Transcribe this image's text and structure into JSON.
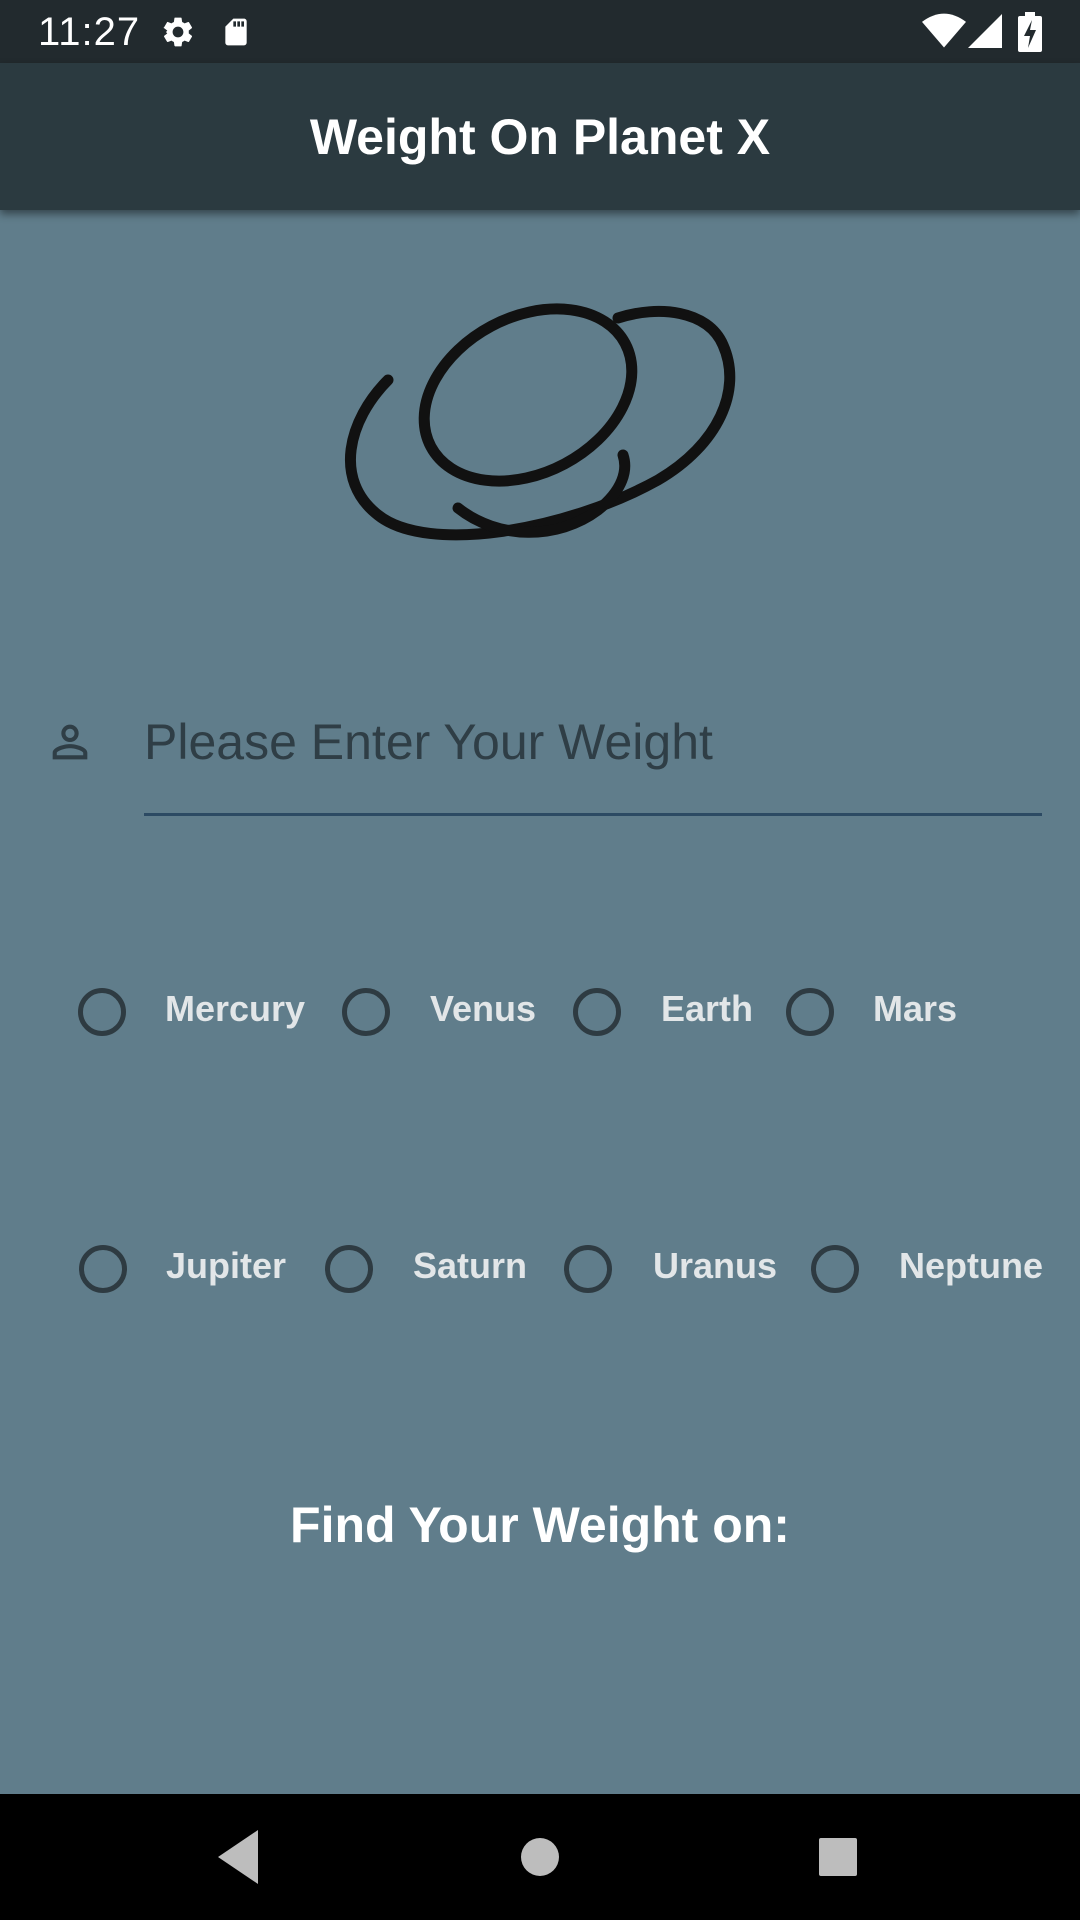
{
  "status_bar": {
    "time": "11:27",
    "icons": [
      "settings-icon",
      "sd-card-icon",
      "wifi-icon",
      "cell-signal-icon",
      "battery-charging-icon"
    ]
  },
  "app_bar": {
    "title": "Weight On Planet X"
  },
  "logo": {
    "icon": "planet-icon"
  },
  "weight_input": {
    "icon": "person-icon",
    "placeholder": "Please Enter Your Weight",
    "value": ""
  },
  "planets": {
    "row1": [
      {
        "label": "Mercury",
        "selected": false
      },
      {
        "label": "Venus",
        "selected": false
      },
      {
        "label": "Earth",
        "selected": false
      },
      {
        "label": "Mars",
        "selected": false
      }
    ],
    "row2": [
      {
        "label": "Jupiter",
        "selected": false
      },
      {
        "label": "Saturn",
        "selected": false
      },
      {
        "label": "Uranus",
        "selected": false
      },
      {
        "label": "Neptune",
        "selected": false
      }
    ]
  },
  "result": {
    "label": "Find Your Weight on:"
  },
  "nav_bar": {
    "buttons": [
      "back-icon",
      "home-icon",
      "recents-icon"
    ]
  },
  "colors": {
    "background": "#607d8b",
    "app_bar": "#2b3a40",
    "status_bar": "#222a2e",
    "input_text": "#2f3e46",
    "radio_label": "#e2e6e8"
  }
}
